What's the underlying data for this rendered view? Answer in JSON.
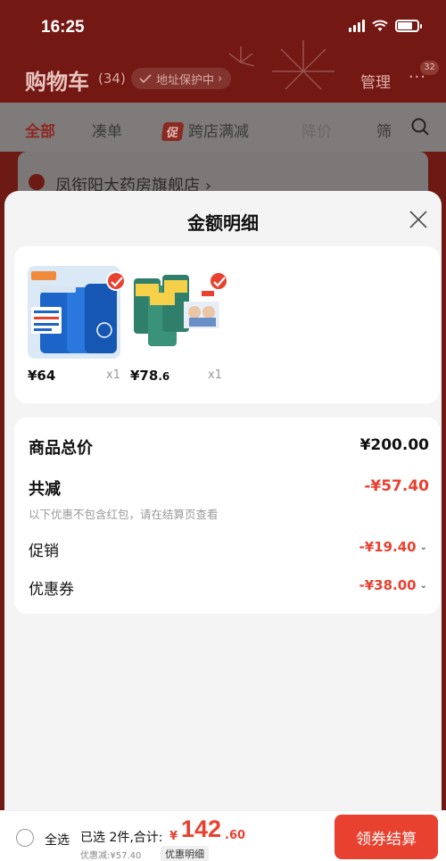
{
  "status_bar": {
    "time": "16:25"
  },
  "header": {
    "title": "购物车",
    "count": "(34)",
    "address_chip": "地址保护中",
    "manage": "管理",
    "more": "···",
    "badge": "32"
  },
  "filters": [
    {
      "label": "全部",
      "state": "active"
    },
    {
      "label": "凑单",
      "state": "normal"
    },
    {
      "label": "跨店满减",
      "badge": "促",
      "state": "normal"
    },
    {
      "label": "降价",
      "state": "faded"
    },
    {
      "label": "筛",
      "state": "normal"
    }
  ],
  "store": {
    "name": "凤衔阳大药房旗舰店 ›"
  },
  "sheet": {
    "title": "金额明细",
    "products": [
      {
        "price": "¥64",
        "qty": "x1",
        "image": "blue-supplement-bottles"
      },
      {
        "price_main": "¥78",
        "price_dec": ".6",
        "qty": "x1",
        "image": "milk-powder-cans"
      }
    ],
    "summary": {
      "total_label": "商品总价",
      "total_value": "¥200.00",
      "reduce_label": "共减",
      "reduce_value": "-¥57.40",
      "note": "以下优惠不包含红包，请在结算页查看",
      "promo_label": "促销",
      "promo_value": "-¥19.40",
      "coupon_label": "优惠券",
      "coupon_value": "-¥38.00"
    }
  },
  "bottom_bar": {
    "select_all": "全选",
    "selected_text": "已选 2件,合计:",
    "currency": "¥",
    "total_int": "142",
    "total_dec": ".60",
    "discount_text": "优惠减:¥57.40",
    "detail_link": "优惠明细",
    "checkout": "领券结算"
  },
  "colors": {
    "accent_red": "#e8412f",
    "header_bg": "#741813"
  }
}
